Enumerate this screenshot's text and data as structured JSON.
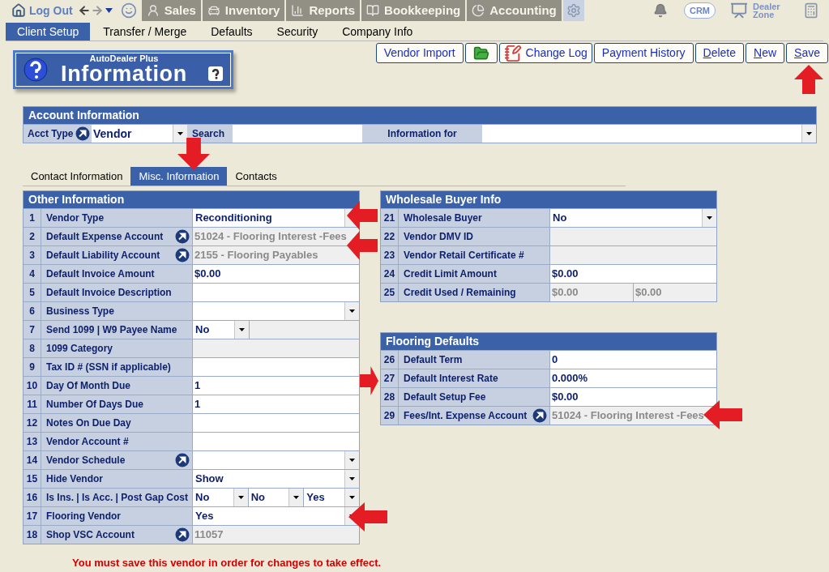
{
  "nav": {
    "logout": "Log Out",
    "tabs": [
      "Sales",
      "Inventory",
      "Reports",
      "Bookkeeping",
      "Accounting"
    ],
    "crm": "CRM",
    "dealer_zone": "Dealer Zone"
  },
  "subnav": [
    {
      "label": "Client Setup",
      "selected": true
    },
    {
      "label": "Transfer / Merge",
      "selected": false
    },
    {
      "label": "Defaults",
      "selected": false
    },
    {
      "label": "Security",
      "selected": false
    },
    {
      "label": "Company Info",
      "selected": false
    }
  ],
  "banner": {
    "brand": "AutoDealer Plus",
    "title": "Information"
  },
  "toolbar": [
    {
      "kind": "text",
      "label": "Vendor Import"
    },
    {
      "kind": "folder"
    },
    {
      "kind": "log",
      "label": "Change Log"
    },
    {
      "kind": "text",
      "label": "Payment History"
    },
    {
      "kind": "accel",
      "label": "Delete"
    },
    {
      "kind": "accel",
      "label": "New"
    },
    {
      "kind": "accel",
      "label": "Save"
    }
  ],
  "account": {
    "title": "Account Information",
    "acct_type_label": "Acct Type",
    "acct_type": "Vendor",
    "search_label": "Search",
    "info_label": "Information for"
  },
  "detail_tabs": [
    {
      "label": "Contact Information",
      "selected": false
    },
    {
      "label": "Misc. Information",
      "selected": true
    },
    {
      "label": "Contacts",
      "selected": false
    }
  ],
  "other": {
    "title": "Other Information",
    "rows": [
      {
        "num": "1",
        "label": "Vendor Type",
        "fields": [
          {
            "kind": "select",
            "value": "Reconditioning"
          }
        ]
      },
      {
        "num": "2",
        "label": "Default Expense Account",
        "link": true,
        "fields": [
          {
            "kind": "readonly",
            "value": "51024 - Flooring Interest -Fees"
          }
        ]
      },
      {
        "num": "3",
        "label": "Default Liability Account",
        "link": true,
        "fields": [
          {
            "kind": "readonly",
            "value": "2155 - Flooring Payables"
          }
        ]
      },
      {
        "num": "4",
        "label": "Default Invoice Amount",
        "fields": [
          {
            "kind": "input",
            "value": "$0.00"
          }
        ]
      },
      {
        "num": "5",
        "label": "Default Invoice Description",
        "fields": [
          {
            "kind": "input"
          }
        ]
      },
      {
        "num": "6",
        "label": "Business Type",
        "fields": [
          {
            "kind": "select"
          }
        ]
      },
      {
        "num": "7",
        "label": "Send 1099 | W9 Payee Name",
        "fields": [
          {
            "kind": "select",
            "value": "No",
            "narrow": true
          },
          {
            "kind": "readonly"
          }
        ]
      },
      {
        "num": "8",
        "label": "1099 Category",
        "fields": [
          {
            "kind": "readonly"
          }
        ]
      },
      {
        "num": "9",
        "label": "Tax ID # (SSN if applicable)",
        "fields": [
          {
            "kind": "input"
          }
        ]
      },
      {
        "num": "10",
        "label": "Day Of Month Due",
        "fields": [
          {
            "kind": "input",
            "value": "1"
          }
        ]
      },
      {
        "num": "11",
        "label": "Number Of Days Due",
        "fields": [
          {
            "kind": "input",
            "value": "1"
          }
        ]
      },
      {
        "num": "12",
        "label": "Notes On Due Day",
        "fields": [
          {
            "kind": "input"
          }
        ]
      },
      {
        "num": "13",
        "label": "Vendor Account #",
        "fields": [
          {
            "kind": "input"
          }
        ]
      },
      {
        "num": "14",
        "label": "Vendor Schedule",
        "link": true,
        "fields": [
          {
            "kind": "select"
          }
        ]
      },
      {
        "num": "15",
        "label": "Hide Vendor",
        "fields": [
          {
            "kind": "select",
            "value": "Show"
          }
        ]
      },
      {
        "num": "16",
        "label": "Is Ins. | Is Acc. | Post Gap Cost",
        "fields": [
          {
            "kind": "select",
            "value": "No"
          },
          {
            "kind": "select",
            "value": "No"
          },
          {
            "kind": "select",
            "value": "Yes"
          }
        ]
      },
      {
        "num": "17",
        "label": "Flooring Vendor",
        "fields": [
          {
            "kind": "select",
            "value": "Yes"
          }
        ]
      },
      {
        "num": "18",
        "label": "Shop VSC Account",
        "link": true,
        "fields": [
          {
            "kind": "readonly",
            "value": "11057"
          }
        ]
      }
    ]
  },
  "wholesale": {
    "title": "Wholesale Buyer Info",
    "rows": [
      {
        "num": "21",
        "label": "Wholesale Buyer",
        "fields": [
          {
            "kind": "select",
            "value": "No"
          }
        ]
      },
      {
        "num": "22",
        "label": "Vendor DMV ID",
        "fields": [
          {
            "kind": "readonly"
          }
        ]
      },
      {
        "num": "23",
        "label": "Vendor Retail Certificate #",
        "fields": [
          {
            "kind": "readonly"
          }
        ]
      },
      {
        "num": "24",
        "label": "Credit Limit Amount",
        "fields": [
          {
            "kind": "input",
            "value": "$0.00"
          }
        ]
      },
      {
        "num": "25",
        "label": "Credit Used / Remaining",
        "fields": [
          {
            "kind": "readonly",
            "value": "$0.00"
          },
          {
            "kind": "readonly",
            "value": "$0.00"
          }
        ]
      }
    ]
  },
  "flooring": {
    "title": "Flooring Defaults",
    "rows": [
      {
        "num": "26",
        "label": "Default Term",
        "fields": [
          {
            "kind": "input",
            "value": "0"
          }
        ]
      },
      {
        "num": "27",
        "label": "Default Interest Rate",
        "fields": [
          {
            "kind": "input",
            "value": "0.000%"
          }
        ]
      },
      {
        "num": "28",
        "label": "Default Setup Fee",
        "fields": [
          {
            "kind": "input",
            "value": "$0.00"
          }
        ]
      },
      {
        "num": "29",
        "label": "Fees/Int. Expense Account",
        "link": true,
        "fields": [
          {
            "kind": "readonly",
            "value": "51024 - Flooring Interest -Fees"
          }
        ]
      }
    ]
  },
  "notice": "You must save this vendor in order for changes to take effect."
}
